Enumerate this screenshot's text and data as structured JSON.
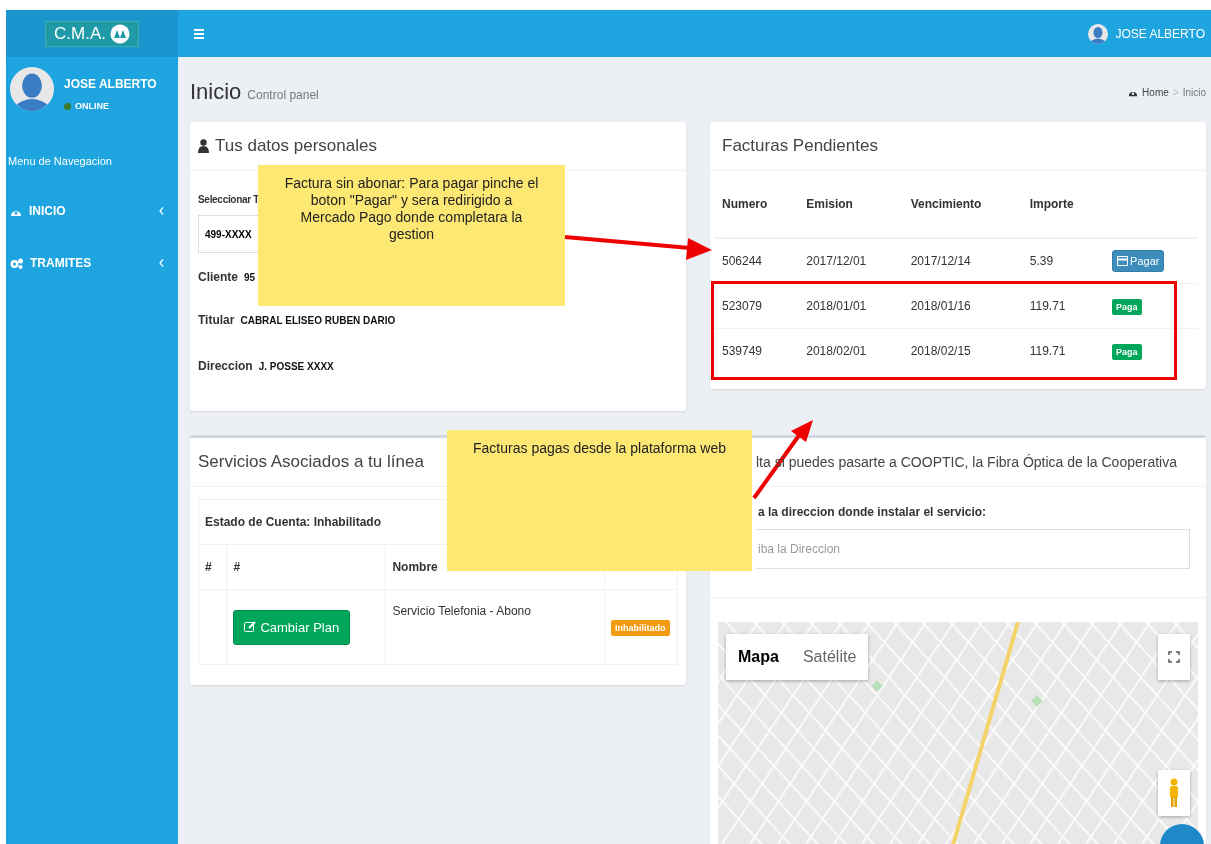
{
  "brand": {
    "logo_text": "C.M.A."
  },
  "topbar": {
    "user_name": "JOSE ALBERTO"
  },
  "sidebar": {
    "user": {
      "name": "JOSE ALBERTO",
      "status": "ONLINE",
      "online": true
    },
    "heading": "Menu de Navegacion",
    "items": [
      {
        "label": "INICIO",
        "kind": "dashboard"
      },
      {
        "label": "TRAMITES",
        "kind": "gears"
      }
    ]
  },
  "page_header": {
    "title": "Inicio",
    "subtitle": "Control panel",
    "breadcrumb": {
      "items": [
        "Home",
        "Inicio"
      ],
      "separator": ">"
    }
  },
  "personal_data": {
    "title": "Tus datos personales",
    "select_label": "Seleccionar T",
    "select_value": "499-XXXX",
    "fields": [
      {
        "label": "Cliente",
        "value": "95"
      },
      {
        "label": "Titular",
        "value": "CABRAL ELISEO RUBEN DARIO"
      },
      {
        "label": "Direccion",
        "value": "J. POSSE XXXX"
      }
    ]
  },
  "invoices": {
    "title": "Facturas Pendientes",
    "columns": [
      "Numero",
      "Emision",
      "Vencimiento",
      "Importe"
    ],
    "rows": [
      {
        "numero": "506244",
        "emision": "2017/12/01",
        "vencimiento": "2017/12/14",
        "importe": "5.39",
        "kind": "unpaid",
        "action": "Pagar"
      },
      {
        "numero": "523079",
        "emision": "2018/01/01",
        "vencimiento": "2018/01/16",
        "importe": "119.71",
        "kind": "paid",
        "action": "Paga"
      },
      {
        "numero": "539749",
        "emision": "2018/02/01",
        "vencimiento": "2018/02/15",
        "importe": "119.71",
        "kind": "paid",
        "action": "Paga"
      }
    ]
  },
  "services": {
    "title": "Servicios Asociados a tu línea",
    "account_state": "Estado de Cuenta: Inhabilitado",
    "columns": [
      "#",
      "#",
      "Nombre"
    ],
    "rows": [
      {
        "button": "Cambiar Plan",
        "name": "Servicio Telefonia - Abono",
        "status": "Inhabilitado"
      }
    ]
  },
  "fiber": {
    "title": "lta si puedes pasarte a COOPTIC, la Fibra Óptica de la Cooperativa",
    "label": "a la direccion donde instalar el servicio:",
    "placeholder": "iba la Direccion",
    "map_tabs": [
      {
        "label": "Mapa",
        "selected": true
      },
      {
        "label": "Satélite",
        "selected": false
      }
    ]
  },
  "annotations": {
    "callouts": [
      "Factura sin abonar: Para pagar pinche el boton \"Pagar\" y sera redirigido a Mercado Pago donde completara la gestion",
      "Facturas pagas desde la plataforma web"
    ]
  }
}
